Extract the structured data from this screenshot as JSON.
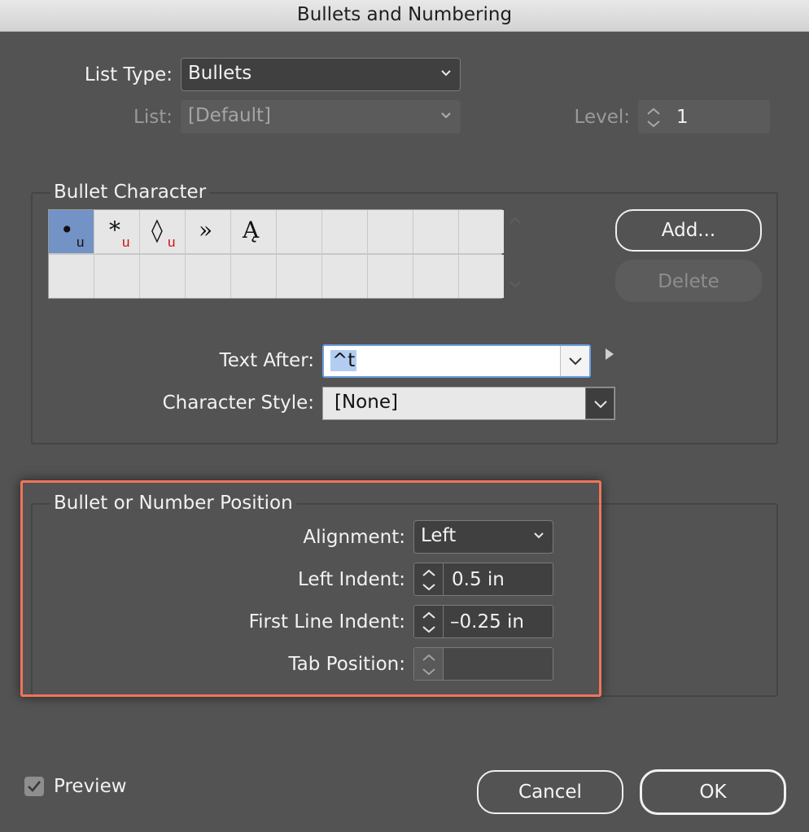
{
  "window": {
    "title": "Bullets and Numbering"
  },
  "list_type": {
    "label": "List Type:",
    "value": "Bullets"
  },
  "list": {
    "label": "List:",
    "value": "[Default]"
  },
  "level": {
    "label": "Level:",
    "value": "1"
  },
  "bullet_character": {
    "title": "Bullet Character",
    "glyphs": [
      {
        "char": "•",
        "sub": "u",
        "sub_color": "#111111",
        "selected": true
      },
      {
        "char": "*",
        "sub": "u",
        "sub_color": "#d01010",
        "selected": false
      },
      {
        "char": "◊",
        "sub": "u",
        "sub_color": "#d01010",
        "selected": false
      },
      {
        "char": "»",
        "sub": "",
        "sub_color": "",
        "selected": false
      },
      {
        "char": "Ą",
        "sub": "",
        "sub_color": "",
        "selected": false
      }
    ],
    "add_label": "Add...",
    "delete_label": "Delete",
    "text_after": {
      "label": "Text After:",
      "value": "^t"
    },
    "character_style": {
      "label": "Character Style:",
      "value": "[None]"
    }
  },
  "position": {
    "title": "Bullet or Number Position",
    "alignment": {
      "label": "Alignment:",
      "value": "Left"
    },
    "left_indent": {
      "label": "Left Indent:",
      "value": "0.5 in"
    },
    "first_line_indent": {
      "label": "First Line Indent:",
      "value": "–0.25 in"
    },
    "tab_position": {
      "label": "Tab Position:",
      "value": ""
    }
  },
  "preview": {
    "label": "Preview",
    "checked": true
  },
  "buttons": {
    "cancel": "Cancel",
    "ok": "OK"
  },
  "colors": {
    "background": "#535353",
    "highlight": "#ef7559",
    "selection": "#7392c5",
    "focus": "#6c9fe0"
  }
}
